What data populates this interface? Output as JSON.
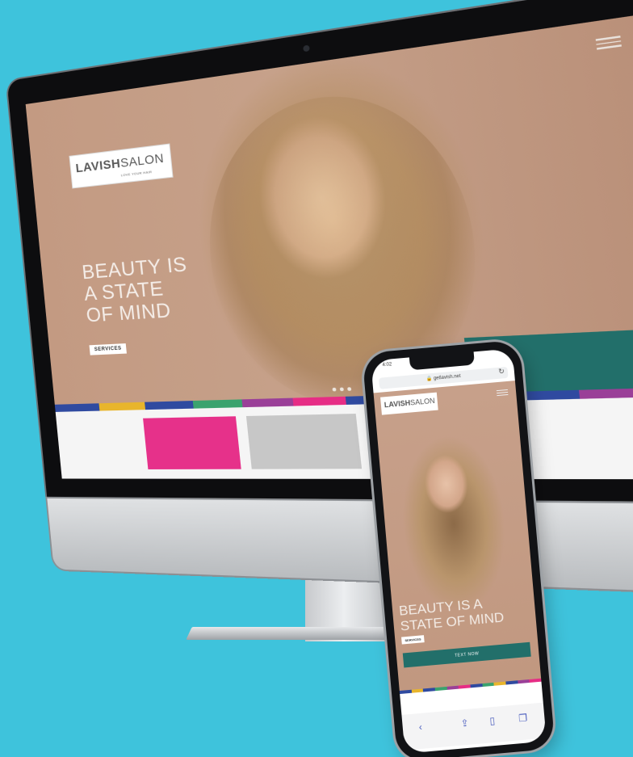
{
  "desktop": {
    "logo": {
      "bold": "LAVISH",
      "light": "SALON",
      "tagline": "LOVE YOUR HAIR"
    },
    "headline": [
      "BEAUTY IS",
      "A STATE",
      "OF MIND"
    ],
    "services_button": "SERVICES",
    "stripe_colors": [
      "#2f4aa0",
      "#e8b52c",
      "#2f4aa0",
      "#3aa36e",
      "#9a3f98",
      "#e62d85",
      "#2f4aa0",
      "#3aa36e",
      "#e8b52c",
      "#2f4aa0",
      "#9a3f98",
      "#e62d85"
    ],
    "tile_colors": [
      "#e6318a",
      "#c7c7c7",
      "#5bb7dd"
    ]
  },
  "mobile": {
    "status_time": "4:02",
    "url": "getlavish.net",
    "logo": {
      "bold": "LAVISH",
      "light": "SALON"
    },
    "headline": [
      "BEAUTY IS A",
      "STATE OF MIND"
    ],
    "services_button": "SERVICES",
    "cta_button": "TEXT NOW"
  },
  "colors": {
    "background": "#3ec3dc",
    "brand_teal": "#226f6a"
  }
}
